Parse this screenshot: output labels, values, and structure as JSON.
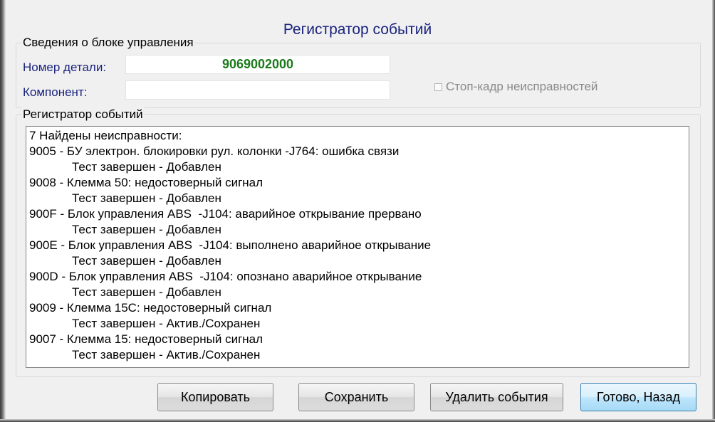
{
  "window": {
    "title": "Регистратор событий"
  },
  "control_unit": {
    "legend": "Сведения о блоке управления",
    "part_number_label": "Номер детали:",
    "part_number_value": "9069002000",
    "component_label": "Компонент:",
    "component_value": "",
    "freeze_frame_label": "Стоп-кадр неисправностей",
    "freeze_frame_checked": false
  },
  "event_log": {
    "legend": "Регистратор событий",
    "lines": [
      {
        "text": "7 Найдены неисправности:",
        "indent": false
      },
      {
        "text": "9005 - БУ электрон. блокировки рул. колонки -J764: ошибка связи",
        "indent": false
      },
      {
        "text": "Тест завершен - Добавлен",
        "indent": true
      },
      {
        "text": "9008 - Клемма 50: недостоверный сигнал",
        "indent": false
      },
      {
        "text": "Тест завершен - Добавлен",
        "indent": true
      },
      {
        "text": "900F - Блок управления ABS  -J104: аварийное открывание прервано",
        "indent": false
      },
      {
        "text": "Тест завершен - Добавлен",
        "indent": true
      },
      {
        "text": "900E - Блок управления ABS  -J104: выполнено аварийное открывание",
        "indent": false
      },
      {
        "text": "Тест завершен - Добавлен",
        "indent": true
      },
      {
        "text": "900D - Блок управления ABS  -J104: опознано аварийное открывание",
        "indent": false
      },
      {
        "text": "Тест завершен - Добавлен",
        "indent": true
      },
      {
        "text": "9009 - Клемма 15С: недостоверный сигнал",
        "indent": false
      },
      {
        "text": "Тест завершен - Актив./Сохранен",
        "indent": true
      },
      {
        "text": "9007 - Клемма 15: недостоверный сигнал",
        "indent": false
      },
      {
        "text": "Тест завершен - Актив./Сохранен",
        "indent": true
      }
    ]
  },
  "buttons": {
    "copy": "Копировать",
    "save": "Сохранить",
    "delete_events": "Удалить события",
    "done_back": "Готово, Назад"
  },
  "colors": {
    "title": "#1a237e",
    "label": "#1a237e",
    "part_number": "#1b7a1b",
    "disabled": "#8a8a8a"
  }
}
